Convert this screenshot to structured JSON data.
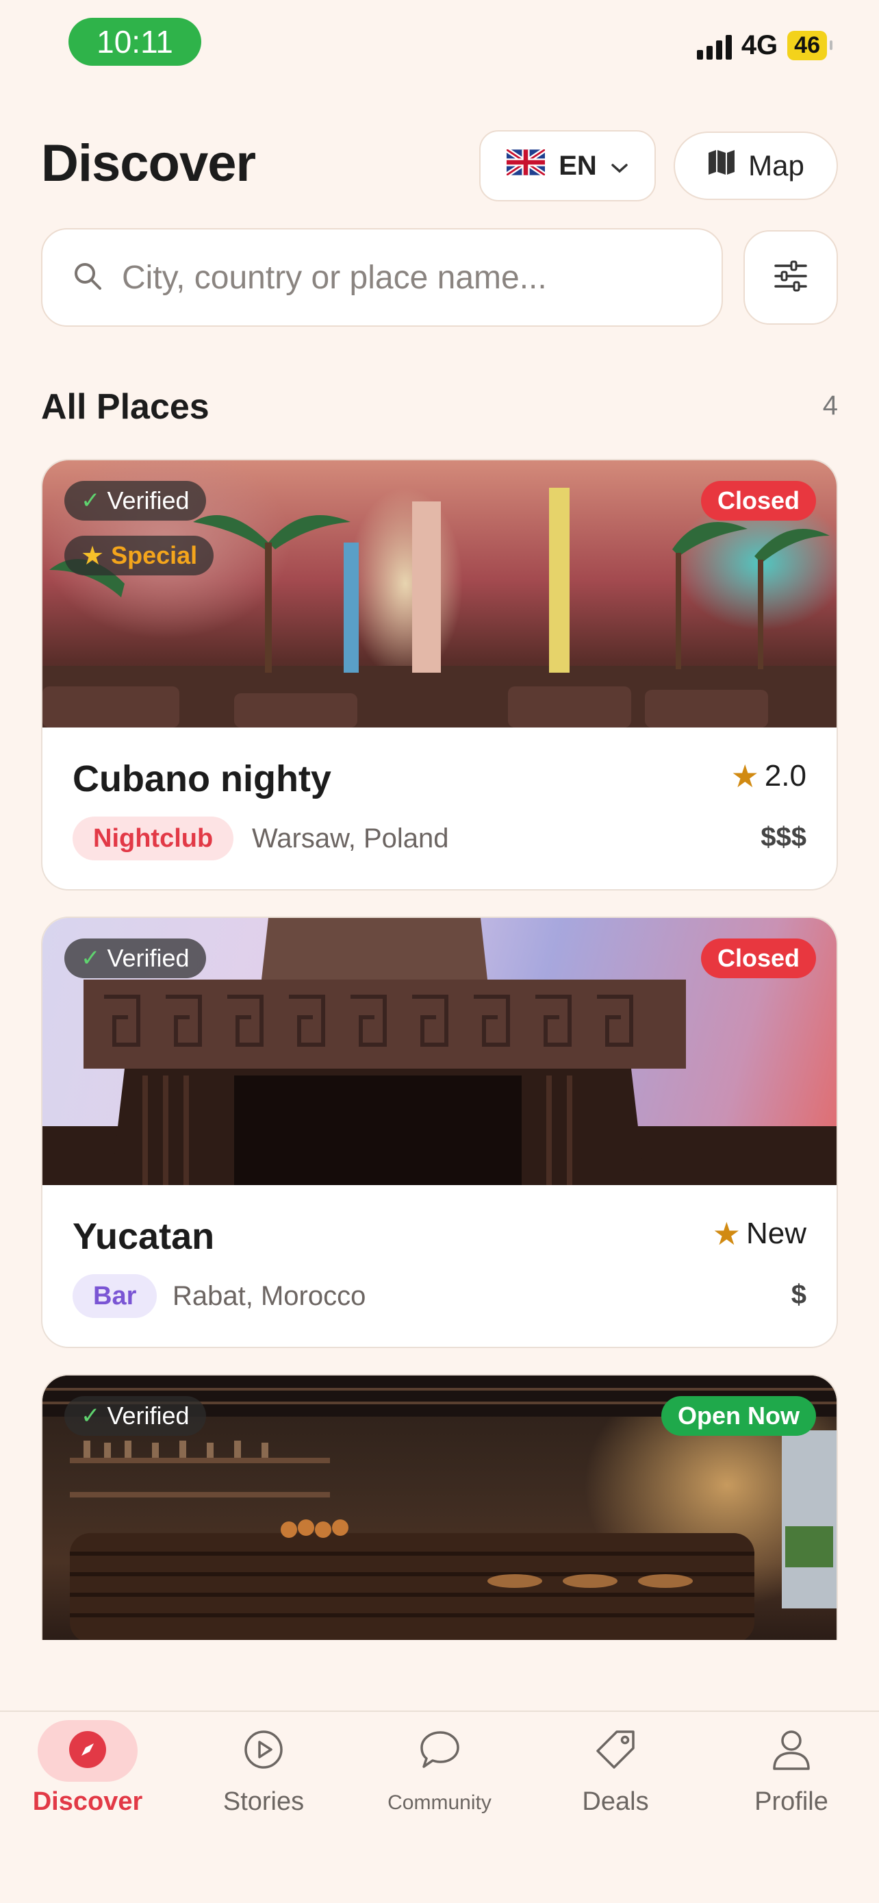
{
  "status_bar": {
    "time": "10:11",
    "network": "4G",
    "battery": "46"
  },
  "header": {
    "title": "Discover",
    "language_label": "EN",
    "map_label": "Map"
  },
  "search": {
    "placeholder": "City, country or place name..."
  },
  "section": {
    "title": "All Places",
    "count": "4"
  },
  "places": [
    {
      "name": "Cubano nighty",
      "verified_label": "Verified",
      "special_label": "Special",
      "status": "Closed",
      "rating": "2.0",
      "category": "Nightclub",
      "location": "Warsaw, Poland",
      "price": "$$$"
    },
    {
      "name": "Yucatan",
      "verified_label": "Verified",
      "status": "Closed",
      "rating": "New",
      "category": "Bar",
      "location": "Rabat, Morocco",
      "price": "$"
    },
    {
      "verified_label": "Verified",
      "status": "Open Now"
    }
  ],
  "tabs": [
    {
      "label": "Discover",
      "icon": "compass-icon",
      "active": true
    },
    {
      "label": "Stories",
      "icon": "play-icon"
    },
    {
      "label": "Community",
      "icon": "chat-icon"
    },
    {
      "label": "Deals",
      "icon": "tag-icon"
    },
    {
      "label": "Profile",
      "icon": "user-icon"
    }
  ],
  "colors": {
    "background": "#fdf4ee",
    "accent": "#e23946",
    "closed": "#e8373f",
    "open": "#1fa94b",
    "status_time_bg": "#2fb34a",
    "battery": "#f3d21b"
  }
}
